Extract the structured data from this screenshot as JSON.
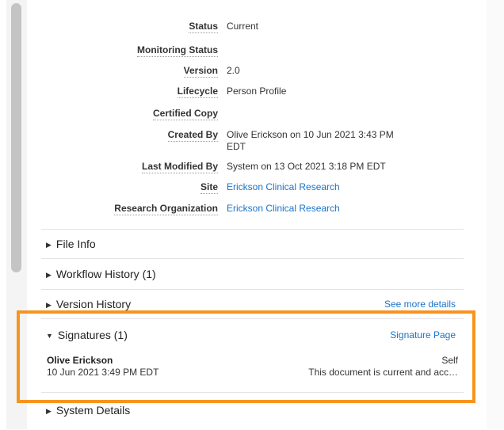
{
  "properties": [
    {
      "label": "Status",
      "value": "Current",
      "link": false
    },
    {
      "label": "Monitoring Status",
      "value": "",
      "link": false
    },
    {
      "label": "Version",
      "value": "2.0",
      "link": false
    },
    {
      "label": "Lifecycle",
      "value": "Person Profile",
      "link": false
    },
    {
      "label": "Certified Copy",
      "value": "",
      "link": false
    },
    {
      "label": "Created By",
      "value": "Olive Erickson on 10 Jun 2021 3:43 PM EDT",
      "link": false
    },
    {
      "label": "Last Modified By",
      "value": "System on 13 Oct 2021 3:18 PM EDT",
      "link": false
    },
    {
      "label": "Site",
      "value": "Erickson Clinical Research",
      "link": true
    },
    {
      "label": "Research Organization",
      "value": "Erickson Clinical Research",
      "link": true
    }
  ],
  "sections": {
    "file_info": {
      "title": "File Info",
      "icon": "caret-right-icon"
    },
    "workflow_history": {
      "title": "Workflow History (1)",
      "icon": "caret-right-icon"
    },
    "version_history": {
      "title": "Version History",
      "icon": "caret-right-icon",
      "link": "See more details"
    },
    "signatures": {
      "title": "Signatures (1)",
      "icon": "caret-down-icon",
      "link": "Signature Page"
    },
    "system_details": {
      "title": "System Details",
      "icon": "caret-right-icon"
    }
  },
  "signature": {
    "name": "Olive Erickson",
    "date": "10 Jun 2021 3:49 PM EDT",
    "role": "Self",
    "description": "This document is current and acc…"
  },
  "colors": {
    "highlight": "#f7941d",
    "link": "#1a73c9"
  }
}
